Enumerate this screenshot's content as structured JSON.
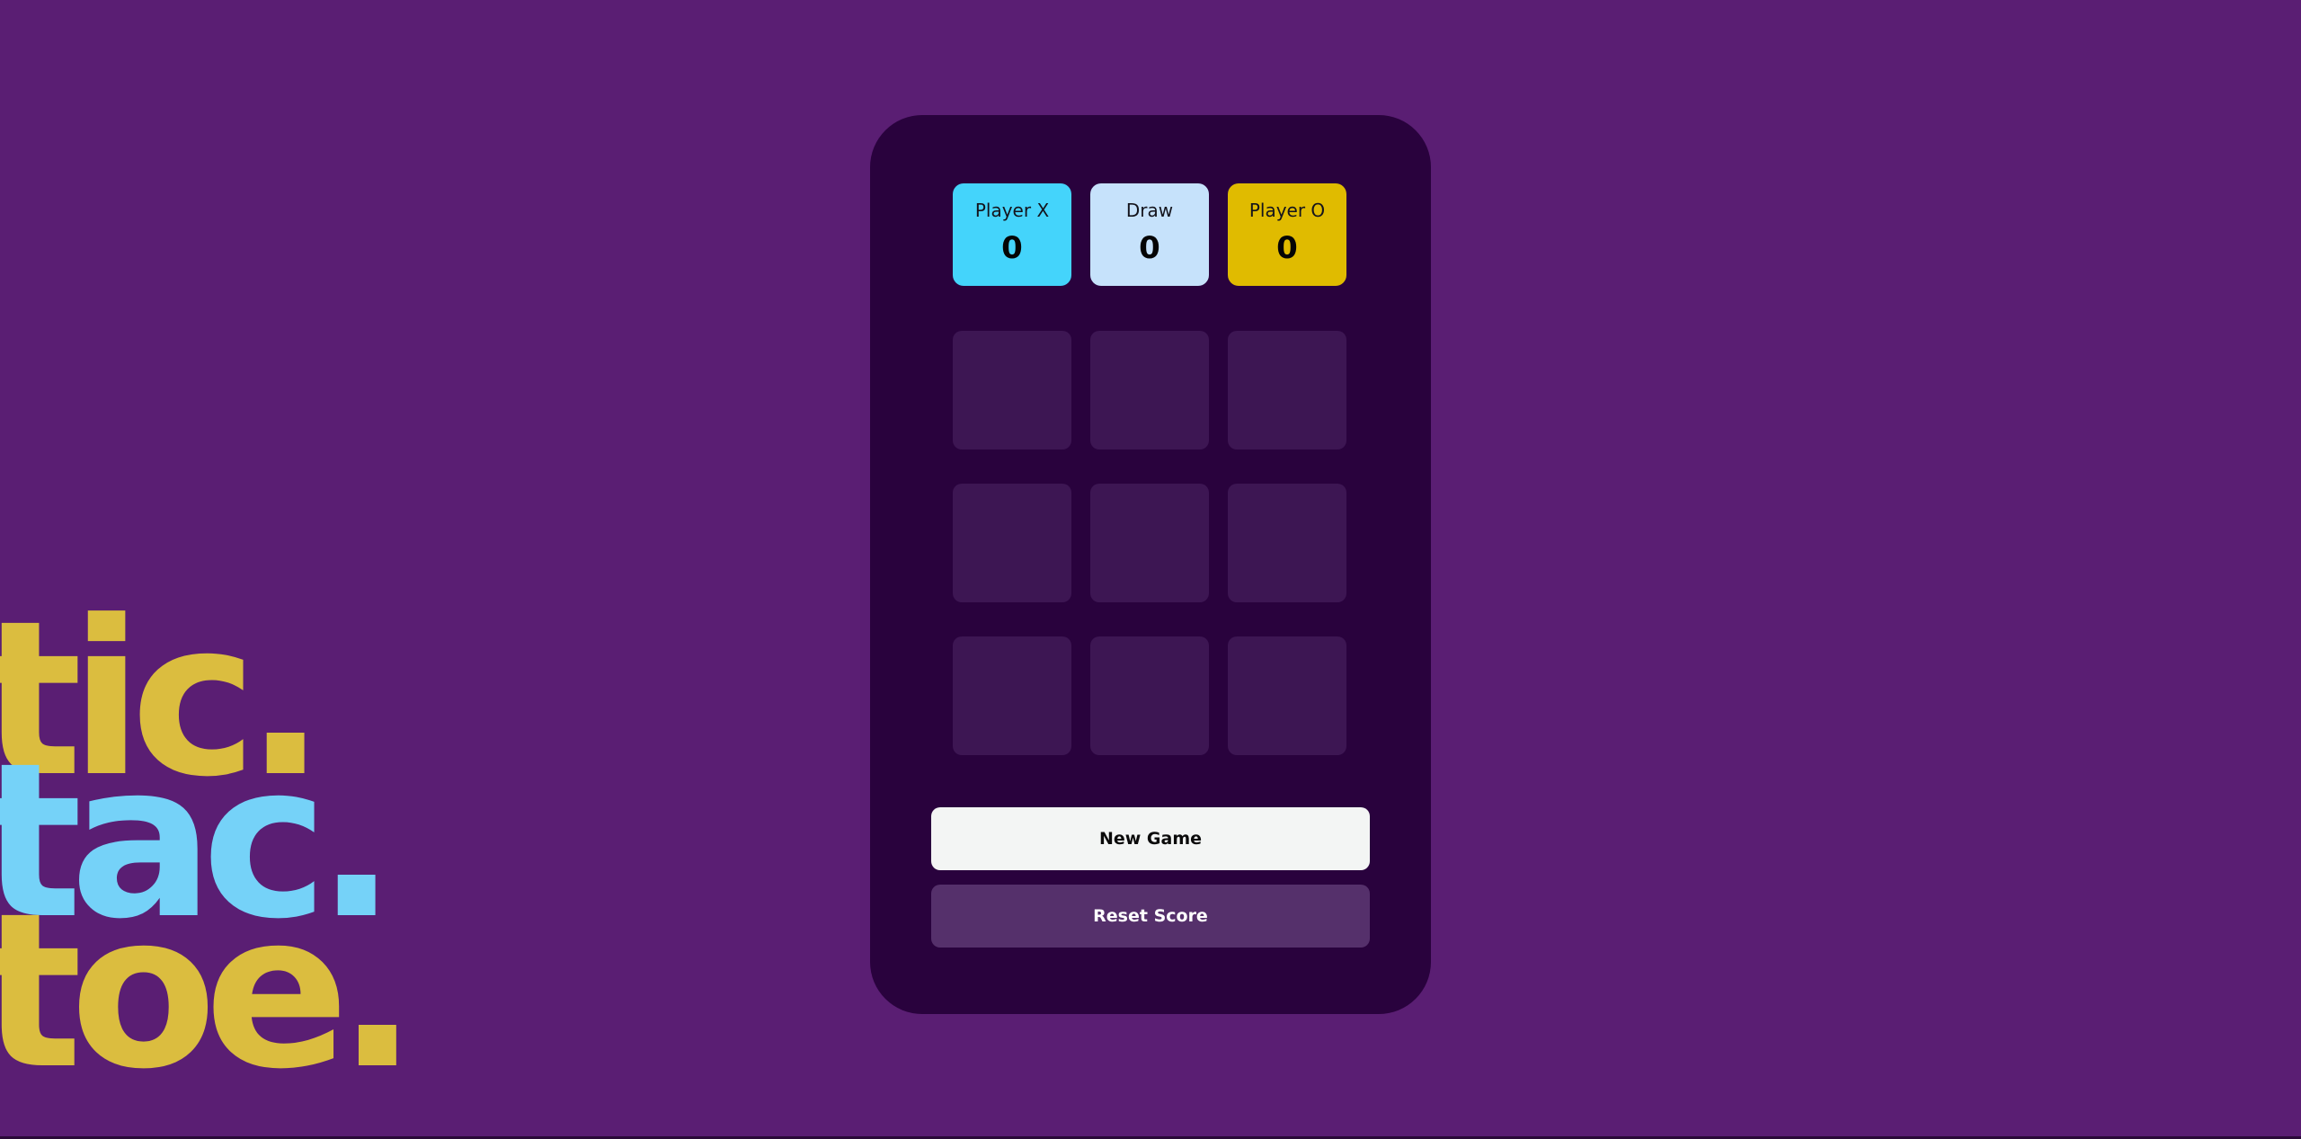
{
  "logo": {
    "line1": "tic.",
    "line2": "tac.",
    "line3": "toe.",
    "colors": {
      "yellow": "#dbbd3f",
      "blue": "#75d2f8"
    }
  },
  "scoreboard": [
    {
      "label": "Player X",
      "value": "0",
      "color": "#44d4fb"
    },
    {
      "label": "Draw",
      "value": "0",
      "color": "#c6e2fb"
    },
    {
      "label": "Player O",
      "value": "0",
      "color": "#e0bb00"
    }
  ],
  "board": {
    "cells": [
      "",
      "",
      "",
      "",
      "",
      "",
      "",
      "",
      ""
    ]
  },
  "buttons": {
    "new_game": "New Game",
    "reset_score": "Reset Score"
  },
  "colors": {
    "background": "#5a1e73",
    "card": "#29023d",
    "cell": "#3d1653"
  }
}
